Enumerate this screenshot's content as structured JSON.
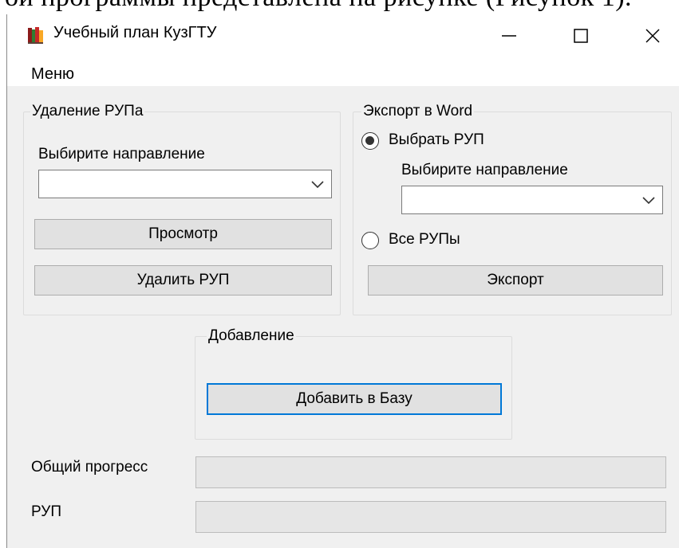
{
  "background_text": "ой программы представлена на рисунке (Рисунок 1).",
  "window": {
    "title": "Учебный план КузГТУ",
    "controls": {
      "minimize": "—",
      "maximize": "☐",
      "close": "✕"
    }
  },
  "menu": {
    "items": [
      {
        "label": "Меню"
      }
    ]
  },
  "delete_group": {
    "legend": "Удаление РУПа",
    "direction_label": "Выбирите направление",
    "direction_value": "",
    "view_button": "Просмотр",
    "delete_button": "Удалить РУП"
  },
  "export_group": {
    "legend": "Экспорт в Word",
    "radio_choose": "Выбрать РУП",
    "radio_choose_checked": true,
    "direction_label": "Выбирите направление",
    "direction_value": "",
    "radio_all": "Все РУПы",
    "radio_all_checked": false,
    "export_button": "Экспорт"
  },
  "add_group": {
    "legend": "Добавление",
    "add_button": "Добавить в Базу"
  },
  "progress": {
    "total_label": "Общий прогресс",
    "total_value": 0,
    "rup_label": "РУП",
    "rup_value": 0
  },
  "colors": {
    "focus": "#0078d7",
    "progress_fill": "#06b025",
    "window_bg": "#f0f0f0"
  }
}
